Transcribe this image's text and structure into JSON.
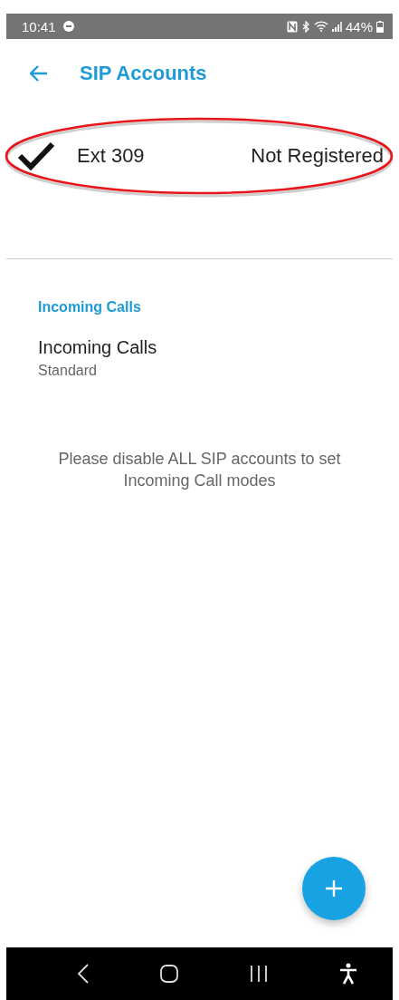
{
  "status_bar": {
    "time": "10:41",
    "battery": "44%"
  },
  "app_bar": {
    "title": "SIP Accounts"
  },
  "accounts": [
    {
      "name": "Ext 309",
      "status": "Not Registered",
      "checked": true,
      "highlighted": true
    }
  ],
  "section": {
    "header": "Incoming Calls",
    "items": [
      {
        "title": "Incoming Calls",
        "subtitle": "Standard"
      }
    ]
  },
  "message": "Please disable ALL SIP accounts to set Incoming Call modes"
}
